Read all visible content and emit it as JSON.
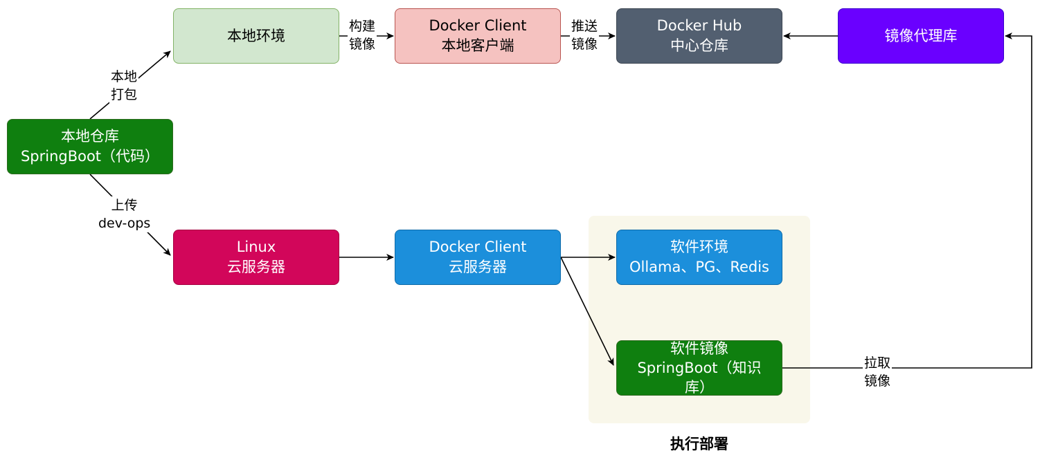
{
  "nodes": {
    "local_repo": {
      "line1": "本地仓库",
      "line2": "SpringBoot（代码）",
      "fill": "#0f7f0f",
      "stroke": "#2d6a1f",
      "text_color": "#ffffff"
    },
    "local_env": {
      "line1": "本地环境",
      "fill": "#d2e7cf",
      "stroke": "#82b366",
      "text_color": "#000000"
    },
    "docker_client_local": {
      "line1": "Docker Client",
      "line2": "本地客户端",
      "fill": "#f5c2c0",
      "stroke": "#b85450",
      "text_color": "#000000"
    },
    "docker_hub": {
      "line1": "Docker Hub",
      "line2": "中心仓库",
      "fill": "#525f70",
      "stroke": "#3d4652",
      "text_color": "#ffffff"
    },
    "mirror_proxy": {
      "line1": "镜像代理库",
      "fill": "#6a00ff",
      "stroke": "#3700cc",
      "text_color": "#ffffff"
    },
    "linux": {
      "line1": "Linux",
      "line2": "云服务器",
      "fill": "#d2065a",
      "stroke": "#a50040",
      "text_color": "#ffffff"
    },
    "docker_client_cloud": {
      "line1": "Docker Client",
      "line2": "云服务器",
      "fill": "#1c8fdb",
      "stroke": "#0e6aa8",
      "text_color": "#ffffff"
    },
    "software_env": {
      "line1": "软件环境",
      "line2": "Ollama、PG、Redis",
      "fill": "#1c8fdb",
      "stroke": "#0e6aa8",
      "text_color": "#ffffff"
    },
    "software_image": {
      "line1": "软件镜像",
      "line2": "SpringBoot（知识",
      "line3": "库）",
      "fill": "#0f7f0f",
      "stroke": "#2d6a1f",
      "text_color": "#ffffff"
    }
  },
  "edges": {
    "local_package": {
      "line1": "本地",
      "line2": "打包"
    },
    "build_image": {
      "line1": "构建",
      "line2": "镜像"
    },
    "push_image": {
      "line1": "推送",
      "line2": "镜像"
    },
    "upload_devops": {
      "line1": "上传",
      "line2": "dev-ops"
    },
    "pull_image": {
      "line1": "拉取",
      "line2": "镜像"
    }
  },
  "group": {
    "label": "执行部署",
    "fill": "#f9f7ea"
  }
}
